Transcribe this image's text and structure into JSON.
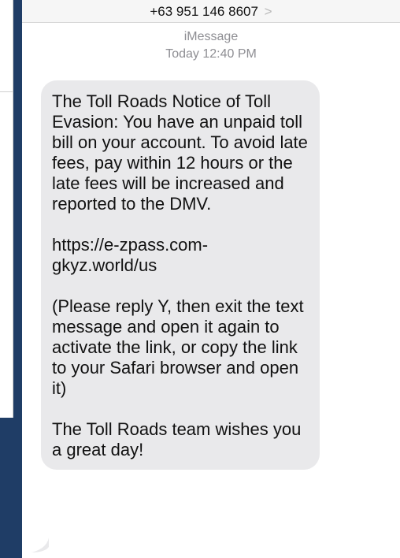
{
  "header": {
    "phone_number": "+63 951 146 8607",
    "chevron": ">"
  },
  "meta": {
    "service": "iMessage",
    "timestamp": "Today 12:40 PM"
  },
  "message": {
    "text": "The Toll Roads Notice of Toll Evasion: You have an unpaid toll bill on your account. To avoid late fees, pay within 12 hours or the late fees will be increased and reported to the DMV.\n\nhttps://e-zpass.com-gkyz.world/us\n\n(Please reply Y, then exit the text message and open it again to activate the link, or copy the link to your Safari browser and open it)\n\nThe Toll Roads team wishes you a great day!"
  },
  "colors": {
    "bubble": "#e9e9eb",
    "background": "#1f3d66",
    "meta_text": "#8e8e93"
  }
}
